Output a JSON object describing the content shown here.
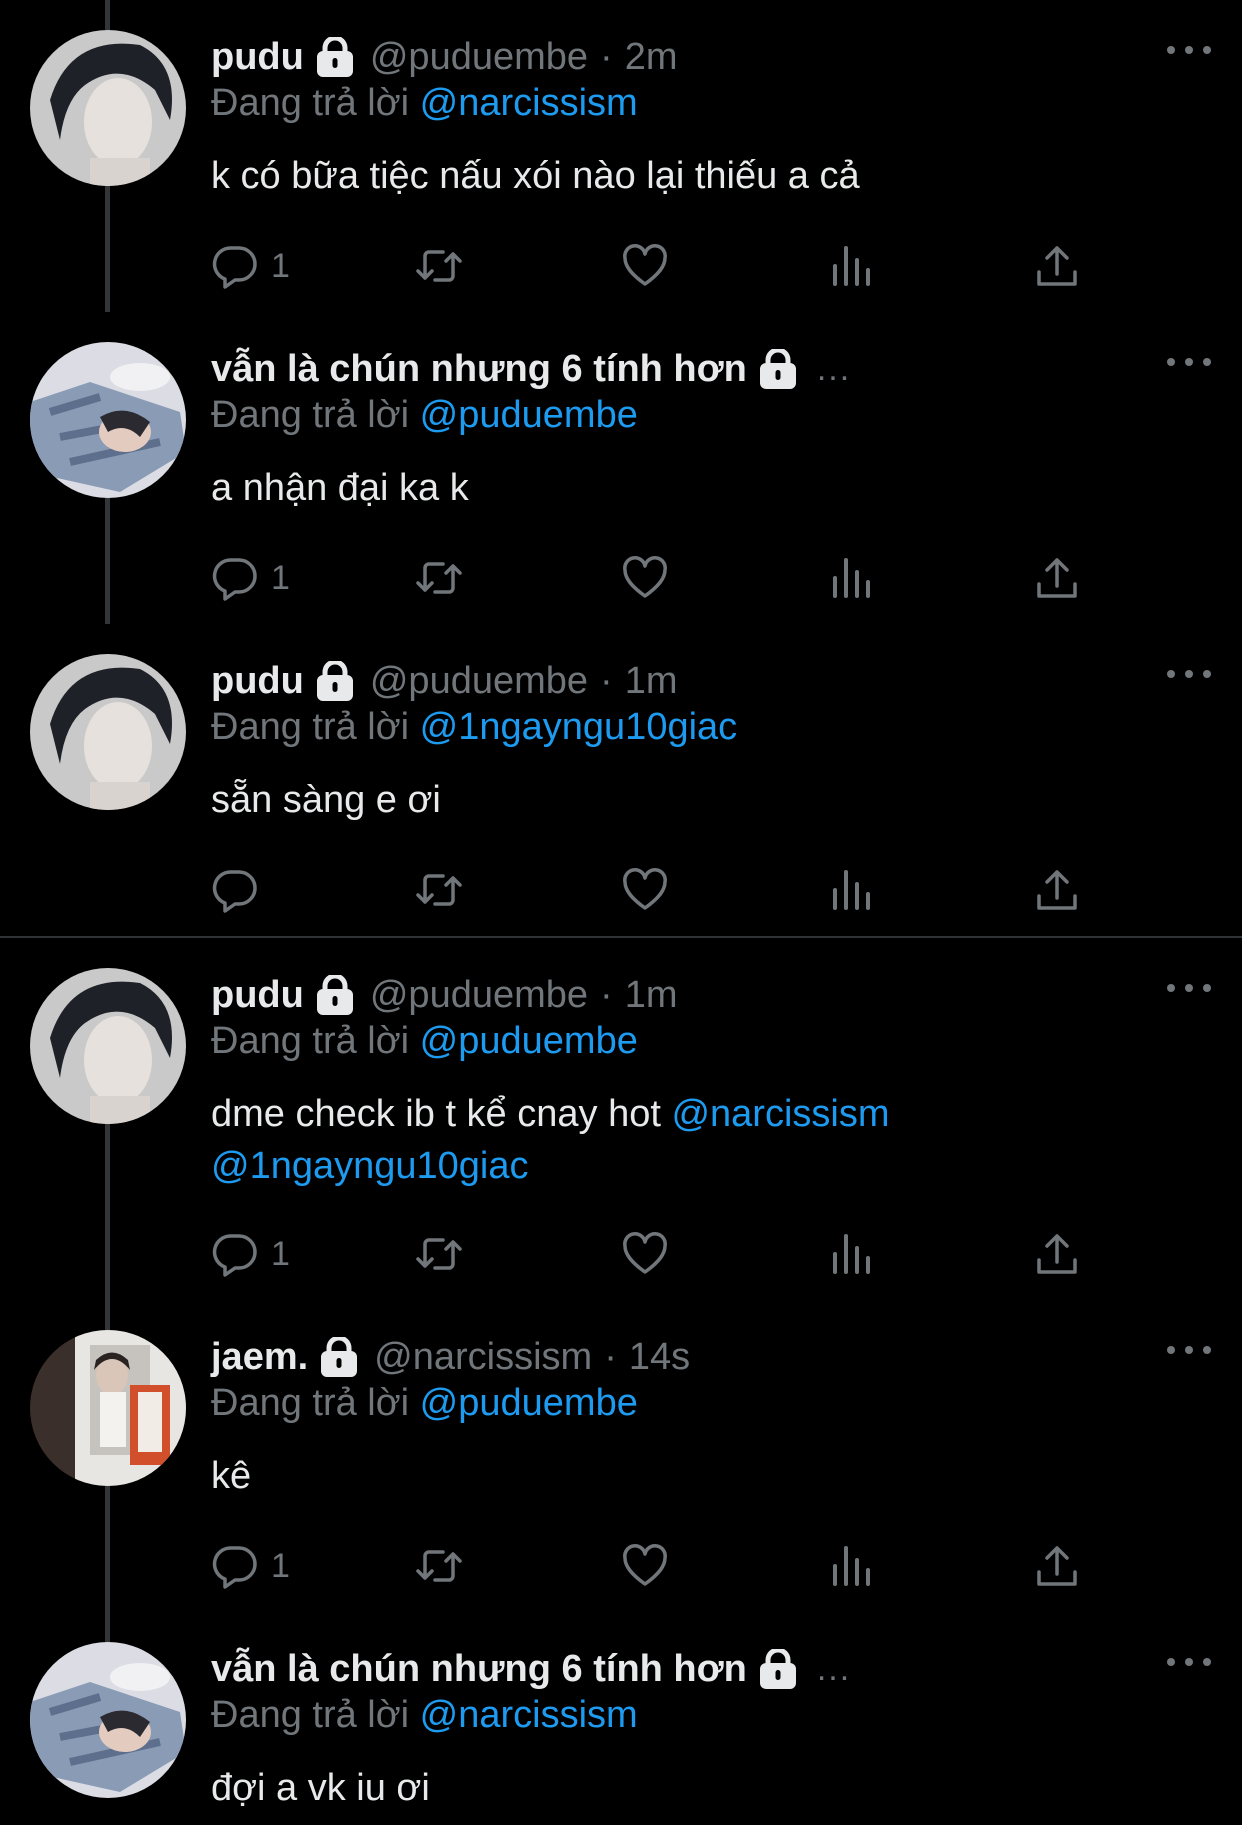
{
  "tweets": [
    {
      "name": "pudu",
      "handle": "@puduembe",
      "time": "2m",
      "replying_prefix": "Đang trả lời",
      "replying_to": "@narcissism",
      "text": "k có bữa tiệc nấu xói nào lại thiếu a cả",
      "mentions": "",
      "mentions_line2": "",
      "reply_count": "1"
    },
    {
      "name": "vẫn là chún nhưng 6 tính hơn",
      "handle": "",
      "time": "",
      "truncation": "...",
      "replying_prefix": "Đang trả lời",
      "replying_to": "@puduembe",
      "text": "a nhận đại ka k",
      "mentions": "",
      "mentions_line2": "",
      "reply_count": "1"
    },
    {
      "name": "pudu",
      "handle": "@puduembe",
      "time": "1m",
      "replying_prefix": "Đang trả lời",
      "replying_to": "@1ngayngu10giac",
      "text": "sẵn sàng e ơi",
      "mentions": "",
      "mentions_line2": "",
      "reply_count": ""
    },
    {
      "name": "pudu",
      "handle": "@puduembe",
      "time": "1m",
      "replying_prefix": "Đang trả lời",
      "replying_to": "@puduembe",
      "text": "dme check ib t kể cnay hot ",
      "mentions": "@narcissism",
      "mentions_line2": "@1ngayngu10giac",
      "reply_count": "1"
    },
    {
      "name": "jaem.",
      "handle": "@narcissism",
      "time": "14s",
      "replying_prefix": "Đang trả lời",
      "replying_to": "@puduembe",
      "text": "kê",
      "mentions": "",
      "mentions_line2": "",
      "reply_count": "1"
    },
    {
      "name": "vẫn là chún nhưng 6 tính hơn",
      "handle": "",
      "time": "",
      "truncation": "...",
      "replying_prefix": "Đang trả lời",
      "replying_to": "@narcissism",
      "text": "đợi a vk iu ơi",
      "mentions": "",
      "mentions_line2": "",
      "reply_count": ""
    }
  ],
  "separator": "·",
  "icons": {
    "lock": "lock-icon",
    "more": "more-icon",
    "reply": "reply-icon",
    "retweet": "retweet-icon",
    "like": "like-icon",
    "views": "views-icon",
    "share": "share-icon"
  },
  "colors": {
    "background": "#000000",
    "text": "#e7e9ea",
    "muted": "#71767b",
    "accent": "#1d9bf0"
  }
}
